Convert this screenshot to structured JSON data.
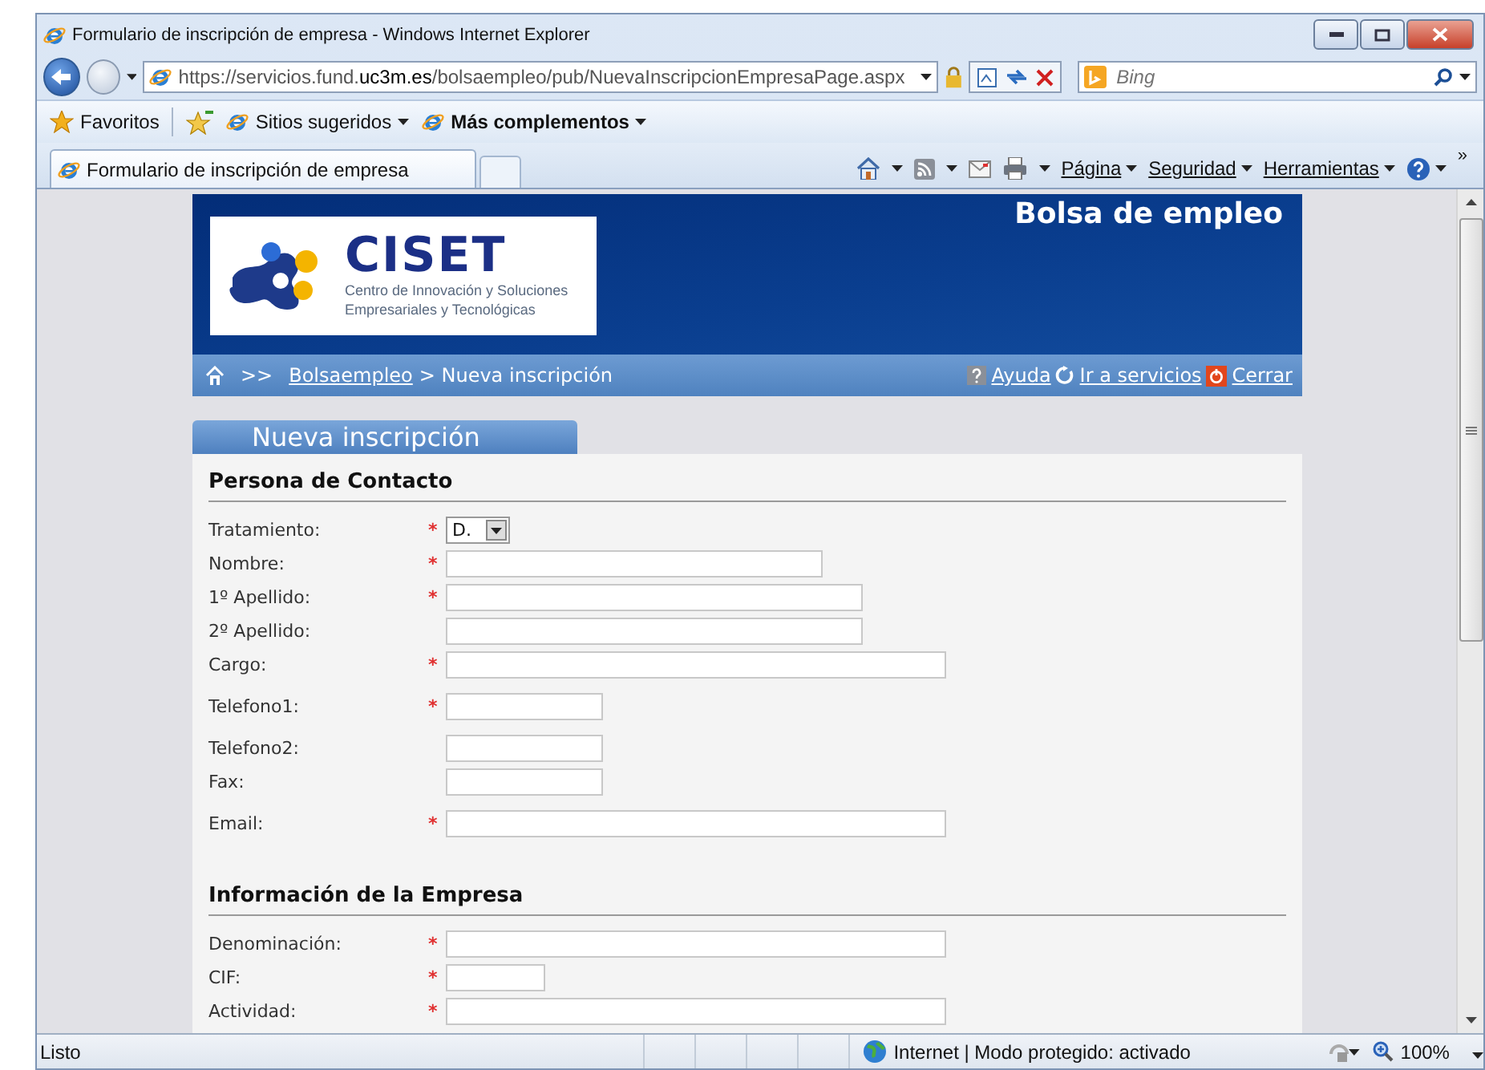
{
  "window": {
    "title": "Formulario de inscripción de empresa - Windows Internet Explorer"
  },
  "address_bar": {
    "url_prefix": "https://servicios.fund.",
    "url_domain": "uc3m.es",
    "url_path": "/bolsaempleo/pub/NuevaInscripcionEmpresaPage.aspx",
    "search_placeholder": "Bing"
  },
  "favorites_bar": {
    "favorites": "Favoritos",
    "items": [
      {
        "label": "Sitios sugeridos",
        "bold": false
      },
      {
        "label": "Más complementos",
        "bold": true
      }
    ]
  },
  "tabs": [
    {
      "label": "Formulario de inscripción de empresa",
      "selected": true
    }
  ],
  "command_bar": {
    "menus": [
      "Página",
      "Seguridad",
      "Herramientas"
    ],
    "overflow": "»"
  },
  "site": {
    "title": "Bolsa de empleo",
    "logo": {
      "name": "CISET",
      "tagline_lines": [
        "Centro de Innovación y Soluciones",
        "Empresariales y Tecnológicas"
      ]
    },
    "breadcrumb": {
      "separator": ">>",
      "link": "Bolsaempleo",
      "current": "> Nueva inscripción"
    },
    "links": [
      {
        "kind": "help",
        "label": "Ayuda"
      },
      {
        "kind": "services",
        "label": "Ir a servicios"
      },
      {
        "kind": "close",
        "label": "Cerrar"
      }
    ],
    "form_tab": "Nueva inscripción"
  },
  "form": {
    "required_mark": "*",
    "sections": [
      {
        "title": "Persona de Contacto",
        "groups": [
          [
            {
              "label": "Tratamiento:",
              "required": true,
              "kind": "select",
              "value": "D."
            },
            {
              "label": "Nombre:",
              "required": true,
              "kind": "medium"
            },
            {
              "label": "1º Apellido:",
              "required": true,
              "kind": "long"
            },
            {
              "label": "2º Apellido:",
              "required": false,
              "kind": "long"
            },
            {
              "label": "Cargo:",
              "required": true,
              "kind": "wide"
            }
          ],
          [
            {
              "label": "Telefono1:",
              "required": true,
              "kind": "short"
            }
          ],
          [
            {
              "label": "Telefono2:",
              "required": false,
              "kind": "short"
            },
            {
              "label": "Fax:",
              "required": false,
              "kind": "short"
            }
          ],
          [
            {
              "label": "Email:",
              "required": true,
              "kind": "wide"
            }
          ]
        ]
      },
      {
        "title": "Información de la Empresa",
        "groups": [
          [
            {
              "label": "Denominación:",
              "required": true,
              "kind": "wide"
            },
            {
              "label": "CIF:",
              "required": true,
              "kind": "tiny"
            },
            {
              "label": "Actividad:",
              "required": true,
              "kind": "wide"
            }
          ]
        ]
      }
    ]
  },
  "status_bar": {
    "status": "Listo",
    "zone": "Internet | Modo protegido: activado",
    "zoom": "100%"
  }
}
